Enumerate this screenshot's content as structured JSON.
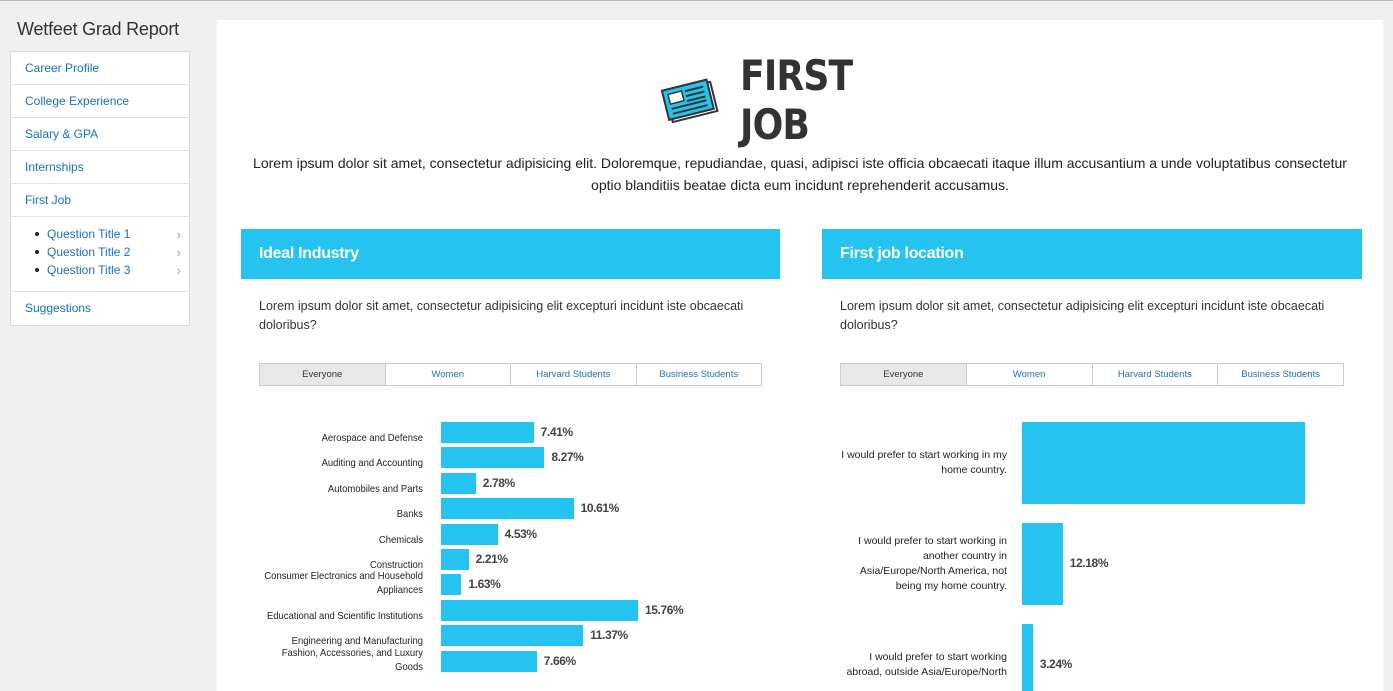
{
  "app": {
    "title": "Wetfeet Grad Report"
  },
  "sidebar": {
    "items": [
      {
        "label": "Career Profile"
      },
      {
        "label": "College Experience"
      },
      {
        "label": "Salary & GPA"
      },
      {
        "label": "Internships"
      },
      {
        "label": "First Job"
      }
    ],
    "subitems": [
      {
        "label": "Question Title 1"
      },
      {
        "label": "Question Title 2"
      },
      {
        "label": "Question Title 3"
      }
    ],
    "last_item": {
      "label": "Suggestions"
    }
  },
  "page": {
    "title": "FIRST JOB",
    "icon": "newspaper-icon",
    "intro": "Lorem ipsum dolor sit amet, consectetur adipisicing elit. Doloremque, repudiandae, quasi, adipisci iste officia obcaecati itaque illum accusantium a unde voluptatibus consectetur optio blanditiis beatae dicta eum incidunt reprehenderit accusamus."
  },
  "colors": {
    "accent": "#25c4f0",
    "link": "#1a72b8"
  },
  "panels": [
    {
      "title": "Ideal Industry",
      "description": "Lorem ipsum dolor sit amet, consectetur adipisicing elit excepturi incidunt iste obcaecati doloribus?",
      "tabs": [
        "Everyone",
        "Women",
        "Harvard Students",
        "Business Students"
      ],
      "active_tab": "Everyone"
    },
    {
      "title": "First job location",
      "description": "Lorem ipsum dolor sit amet, consectetur adipisicing elit excepturi incidunt iste obcaecati doloribus?",
      "tabs": [
        "Everyone",
        "Women",
        "Harvard Students",
        "Business Students"
      ],
      "active_tab": "Everyone"
    }
  ],
  "chart_data": [
    {
      "type": "bar",
      "orientation": "horizontal",
      "categories": [
        "Aerospace and Defense",
        "Auditing and Accounting",
        "Automobiles and Parts",
        "Banks",
        "Chemicals",
        "Construction",
        "Consumer Electronics and Household Appliances",
        "Educational and Scientific Institutions",
        "Engineering and Manufacturing",
        "Fashion, Accessories, and Luxury Goods"
      ],
      "values": [
        7.41,
        8.27,
        2.78,
        10.61,
        4.53,
        2.21,
        1.63,
        15.76,
        11.37,
        7.66
      ],
      "labels": [
        "7.41%",
        "8.27%",
        "2.78%",
        "10.61%",
        "4.53%",
        "2.21%",
        "1.63%",
        "15.76%",
        "11.37%",
        "7.66%"
      ],
      "xlim": [
        0,
        16
      ]
    },
    {
      "type": "bar",
      "orientation": "horizontal",
      "categories": [
        "I would prefer to start working in my home country.",
        "I would prefer to start working in another country in Asia/Europe/North America, not being my home country.",
        "I would prefer to start working abroad, outside Asia/Europe/North"
      ],
      "values": [
        84.58,
        12.18,
        3.24
      ],
      "labels": [
        "",
        "12.18%",
        "3.24%"
      ],
      "xlim": [
        0,
        100
      ]
    }
  ]
}
